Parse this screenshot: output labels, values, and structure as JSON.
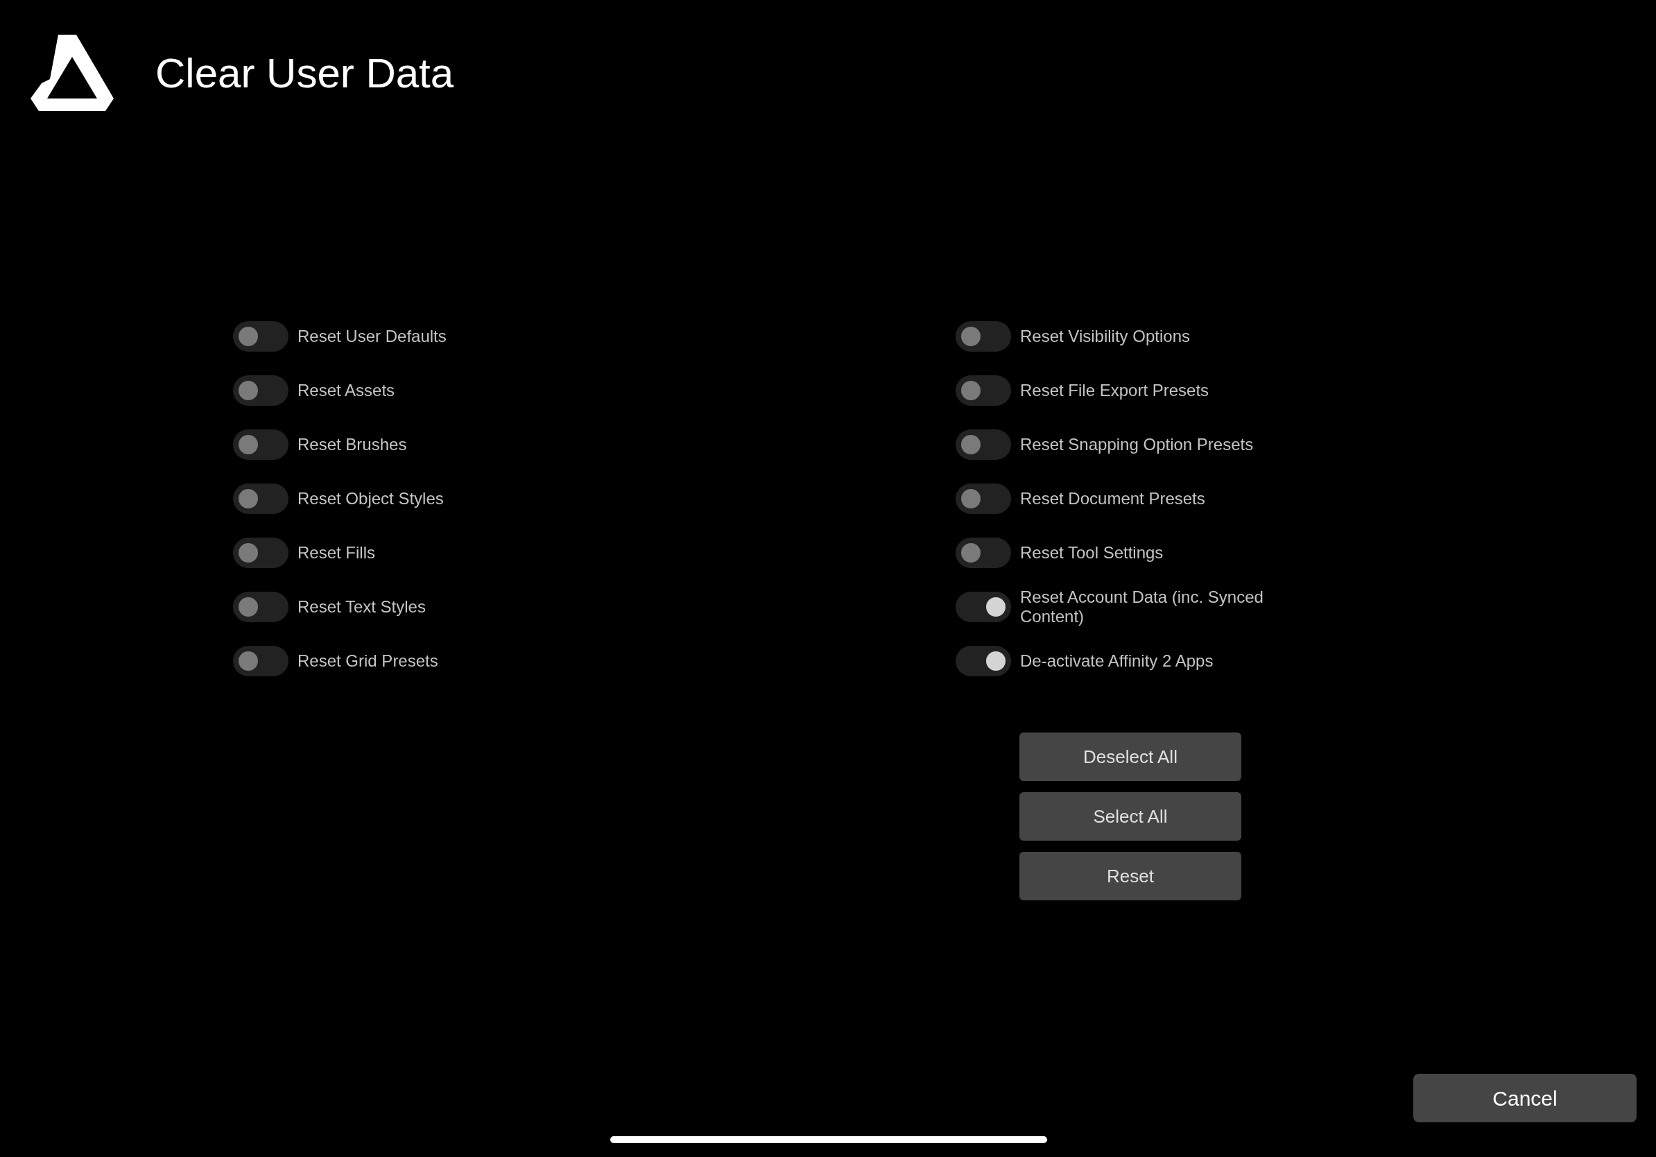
{
  "title": "Clear User Data",
  "left_options": [
    {
      "label": "Reset User Defaults",
      "on": false
    },
    {
      "label": "Reset Assets",
      "on": false
    },
    {
      "label": "Reset Brushes",
      "on": false
    },
    {
      "label": "Reset Object Styles",
      "on": false
    },
    {
      "label": "Reset Fills",
      "on": false
    },
    {
      "label": "Reset Text Styles",
      "on": false
    },
    {
      "label": "Reset Grid Presets",
      "on": false
    }
  ],
  "right_options": [
    {
      "label": "Reset Visibility Options",
      "on": false
    },
    {
      "label": "Reset File Export Presets",
      "on": false
    },
    {
      "label": "Reset Snapping Option Presets",
      "on": false
    },
    {
      "label": "Reset Document Presets",
      "on": false
    },
    {
      "label": "Reset Tool Settings",
      "on": false
    },
    {
      "label": "Reset Account Data (inc. Synced Content)",
      "on": true
    },
    {
      "label": "De-activate Affinity 2 Apps",
      "on": true
    }
  ],
  "buttons": [
    "Deselect All",
    "Select All",
    "Reset"
  ],
  "cancel": "Cancel"
}
